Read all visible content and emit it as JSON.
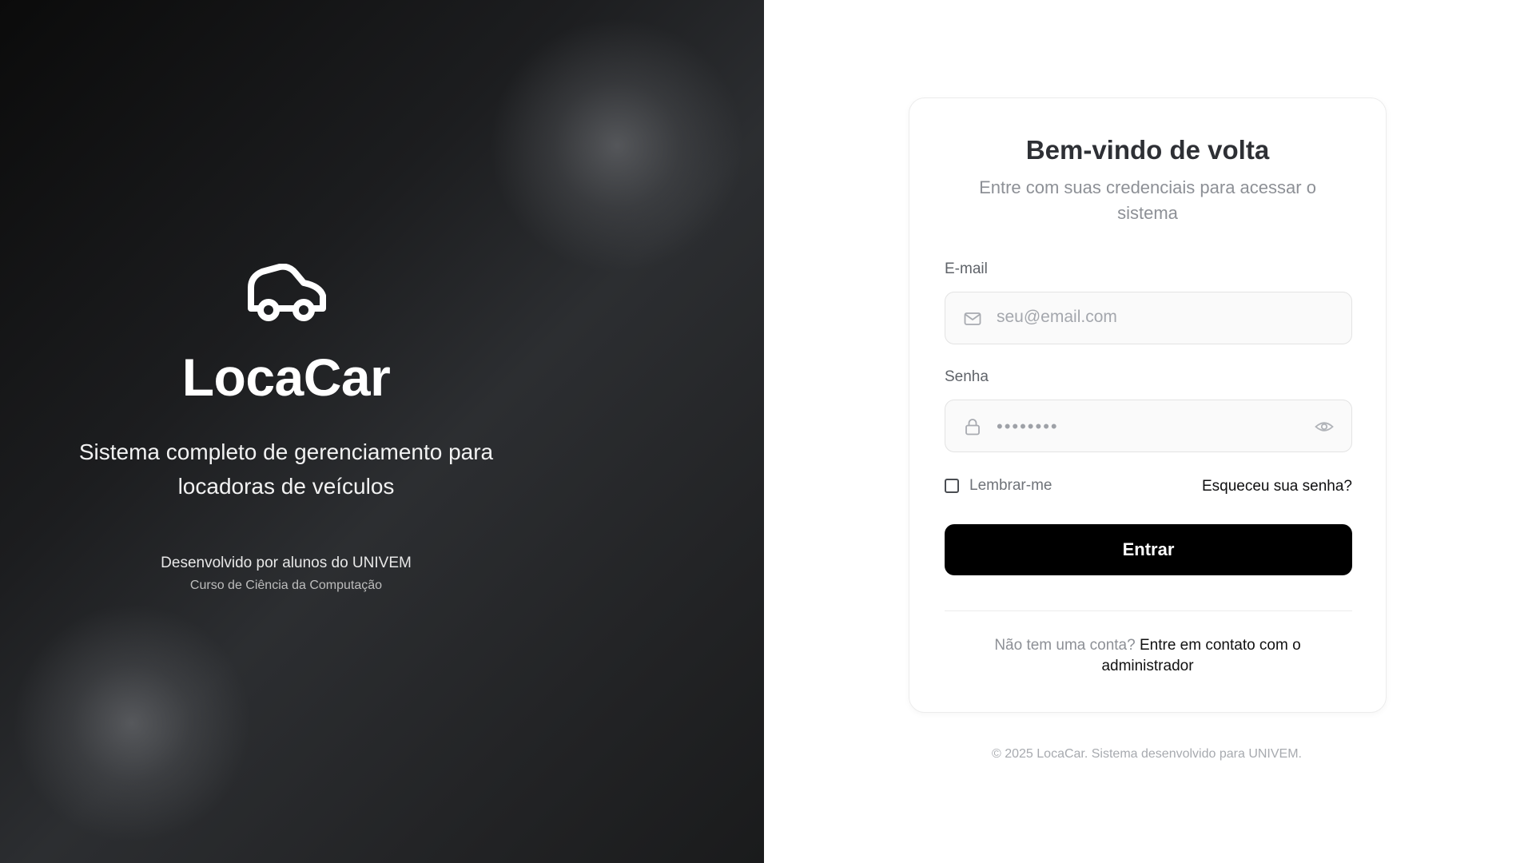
{
  "hero": {
    "brand": "LocaCar",
    "tagline": "Sistema completo de gerenciamento para locadoras de veículos",
    "developed_by": "Desenvolvido por alunos do UNIVEM",
    "course": "Curso de Ciência da Computação",
    "icon": "car-icon"
  },
  "login": {
    "title": "Bem-vindo de volta",
    "subtitle": "Entre com suas credenciais para acessar o sistema",
    "email": {
      "label": "E-mail",
      "placeholder": "seu@email.com",
      "value": "",
      "icon": "mail-icon"
    },
    "password": {
      "label": "Senha",
      "placeholder": "••••••••",
      "value": "",
      "icon": "lock-icon",
      "toggle_icon": "eye-icon"
    },
    "remember_label": "Lembrar-me",
    "remember_checked": false,
    "forgot_label": "Esqueceu sua senha?",
    "submit_label": "Entrar",
    "no_account_text": "Não tem uma conta?",
    "contact_link": "Entre em contato com o administrador"
  },
  "footer": {
    "text": "© 2025 LocaCar. Sistema desenvolvido para UNIVEM."
  },
  "colors": {
    "button_bg": "#000000",
    "button_text": "#ffffff",
    "hero_dark": "#0b0b0b",
    "hero_mid": "#2c2e31"
  }
}
